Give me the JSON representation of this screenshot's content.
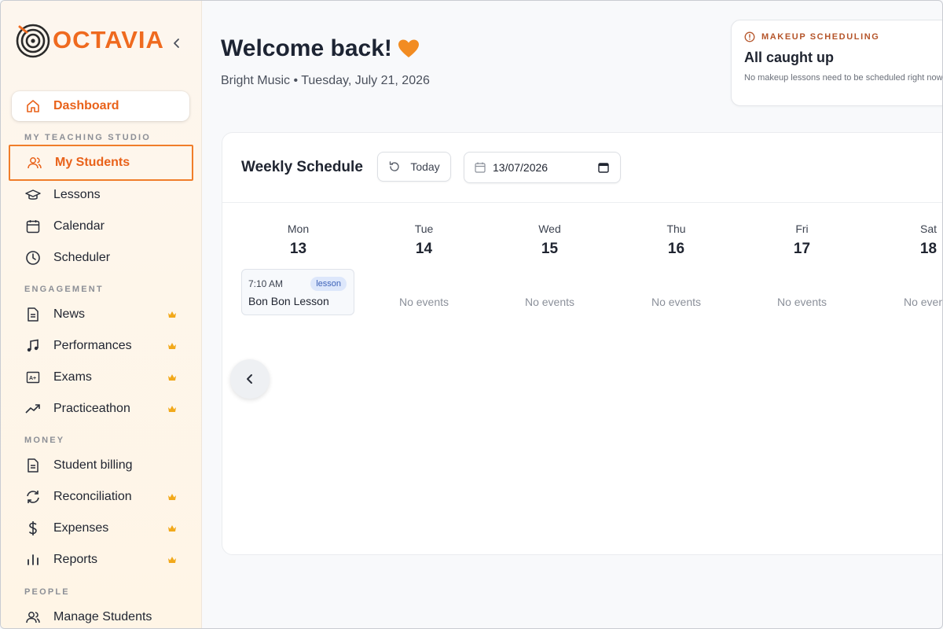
{
  "brand": {
    "name": "OCTAVIA",
    "accent": "#ef6a1f"
  },
  "sidebar": {
    "items": [
      {
        "label": "Dashboard",
        "icon": "home-icon"
      },
      {
        "label": "My Students",
        "icon": "users-icon"
      },
      {
        "label": "Lessons",
        "icon": "graduation-cap-icon"
      },
      {
        "label": "Calendar",
        "icon": "calendar-icon"
      },
      {
        "label": "Scheduler",
        "icon": "clock-icon"
      },
      {
        "label": "News",
        "icon": "document-icon",
        "premium": true
      },
      {
        "label": "Performances",
        "icon": "music-note-icon",
        "premium": true
      },
      {
        "label": "Exams",
        "icon": "grade-icon",
        "premium": true
      },
      {
        "label": "Practiceathon",
        "icon": "trending-up-icon",
        "premium": true
      },
      {
        "label": "Student billing",
        "icon": "document-icon"
      },
      {
        "label": "Reconciliation",
        "icon": "refresh-icon",
        "premium": true
      },
      {
        "label": "Expenses",
        "icon": "dollar-icon",
        "premium": true
      },
      {
        "label": "Reports",
        "icon": "bar-chart-icon",
        "premium": true
      },
      {
        "label": "Manage Students",
        "icon": "users-icon"
      }
    ],
    "sections": {
      "studio": "MY TEACHING STUDIO",
      "engagement": "ENGAGEMENT",
      "money": "MONEY",
      "people": "PEOPLE"
    }
  },
  "header": {
    "welcome": "Welcome back!",
    "subtitle": "Bright Music • Tuesday, July 21, 2026"
  },
  "makeup": {
    "label": "MAKEUP SCHEDULING",
    "title": "All caught up",
    "description": "No makeup lessons need to be scheduled right now."
  },
  "schedule": {
    "title": "Weekly Schedule",
    "today_label": "Today",
    "date_value": "13/07/2026",
    "days": [
      {
        "name": "Mon",
        "num": "13"
      },
      {
        "name": "Tue",
        "num": "14"
      },
      {
        "name": "Wed",
        "num": "15"
      },
      {
        "name": "Thu",
        "num": "16"
      },
      {
        "name": "Fri",
        "num": "17"
      },
      {
        "name": "Sat",
        "num": "18"
      }
    ],
    "no_events": "No events",
    "event": {
      "time": "7:10 AM",
      "badge": "lesson",
      "title": "Bon Bon Lesson"
    }
  }
}
